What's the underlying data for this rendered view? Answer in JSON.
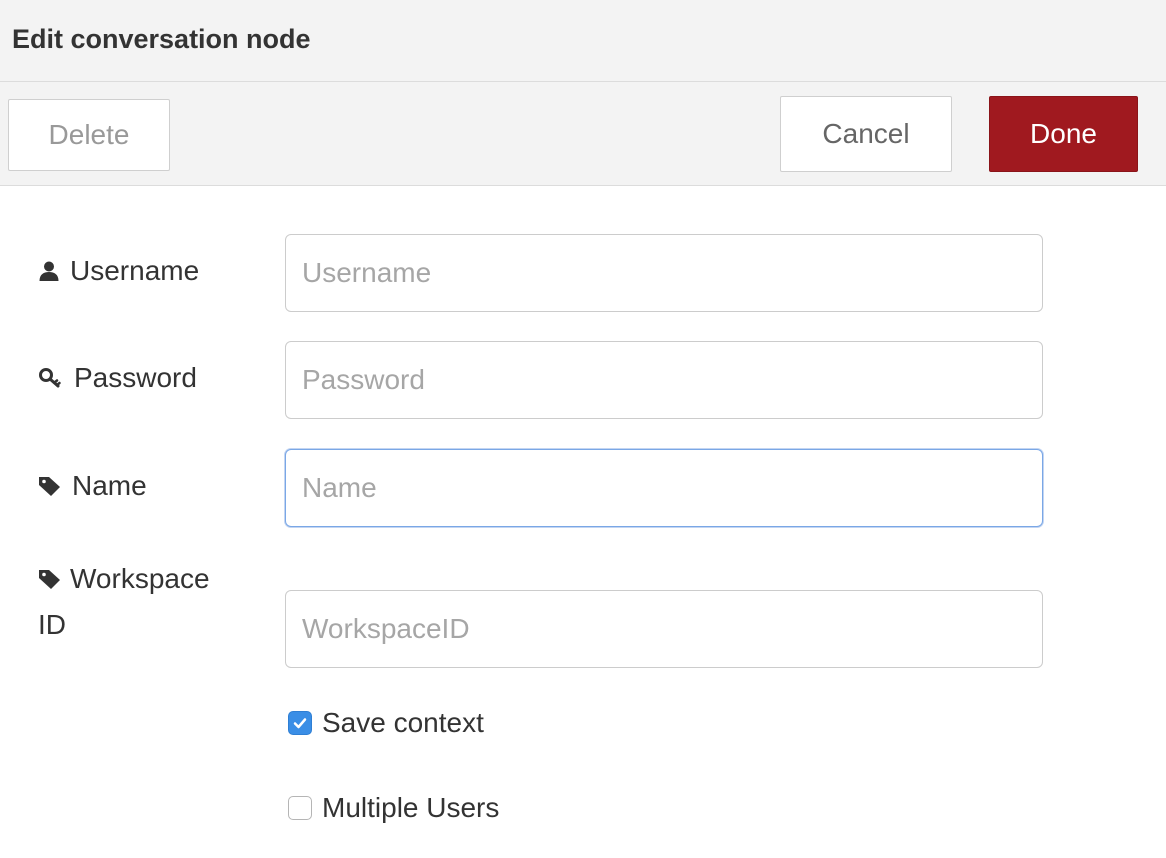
{
  "dialog": {
    "title": "Edit conversation node"
  },
  "buttons": {
    "delete_label": "Delete",
    "cancel_label": "Cancel",
    "done_label": "Done",
    "done_color": "#a0191f"
  },
  "form": {
    "username": {
      "label": "Username",
      "placeholder": "Username",
      "value": "",
      "icon": "user-icon"
    },
    "password": {
      "label": "Password",
      "placeholder": "Password",
      "value": "",
      "icon": "key-icon"
    },
    "name": {
      "label": "Name",
      "placeholder": "Name",
      "value": "",
      "icon": "tag-icon",
      "focused": true
    },
    "workspace": {
      "label_line1": "Workspace",
      "label_line2": "ID",
      "placeholder": "WorkspaceID",
      "value": "",
      "icon": "tag-icon"
    },
    "save_context": {
      "label": "Save context",
      "checked": true
    },
    "multiple_users": {
      "label": "Multiple Users",
      "checked": false
    }
  },
  "colors": {
    "checkbox_checked": "#3a8ee6",
    "focus_border": "#7aa7e6"
  }
}
